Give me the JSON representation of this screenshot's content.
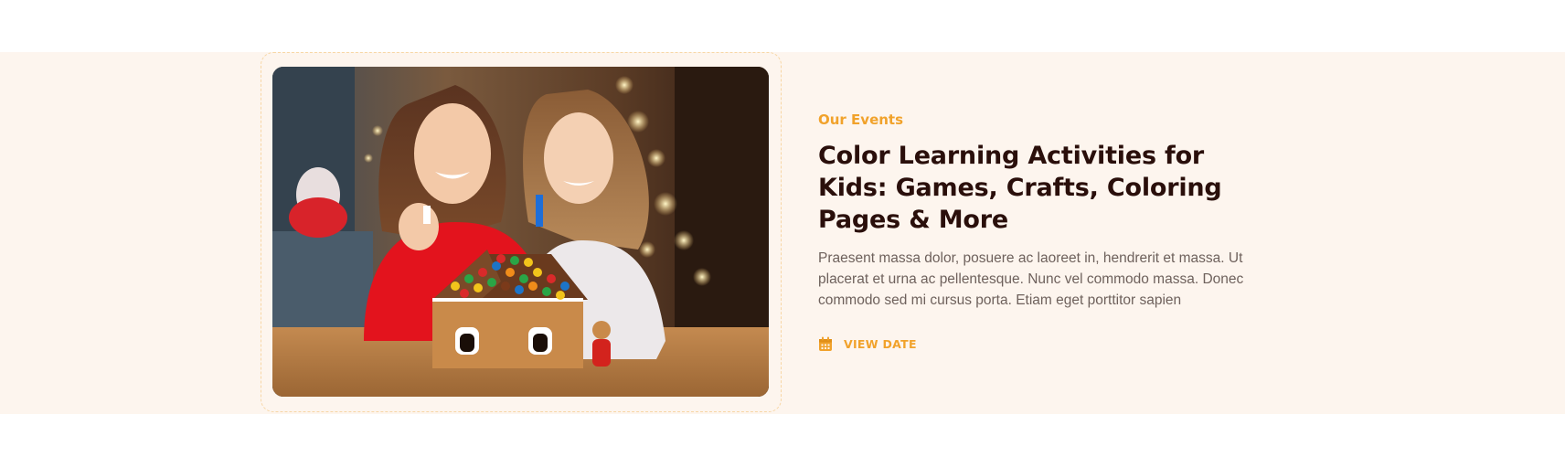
{
  "event": {
    "eyebrow": "Our Events",
    "title": "Color Learning Activities for Kids: Games, Crafts, Coloring Pages & More",
    "description": "Praesent massa dolor, posuere ac laoreet in, hendrerit et massa. Ut placerat et urna ac pellentesque. Nunc vel commodo massa. Donec commodo sed mi cursus porta. Etiam eget porttitor sapien",
    "link_label": "VIEW DATE",
    "link_icon": "calendar-icon",
    "image_alt_icon": "photo-kids-gingerbread-house"
  },
  "colors": {
    "accent": "#f1a22b",
    "band": "#fdf5ee",
    "title": "#2a0f0b",
    "body": "#6e615c",
    "frame_border": "#f7d6a5"
  }
}
